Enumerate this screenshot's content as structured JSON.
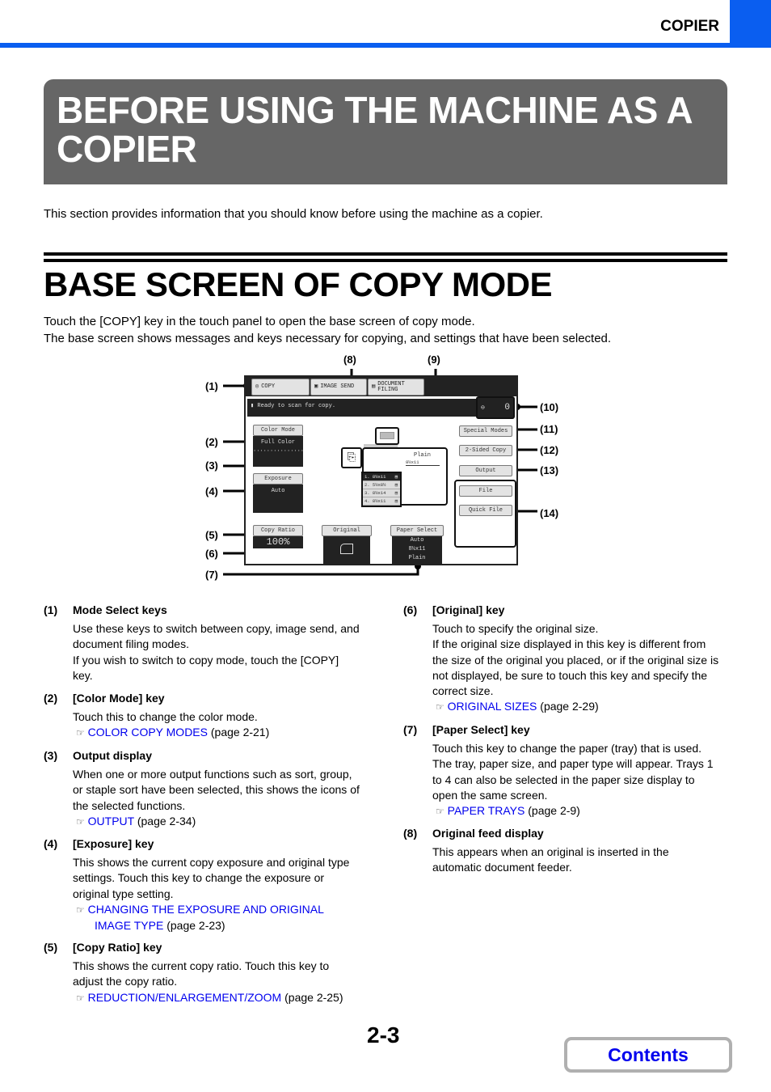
{
  "header": {
    "section_label": "COPIER",
    "accent_color": "#0a5ef0"
  },
  "chapter_title": "BEFORE USING THE MACHINE AS A COPIER",
  "intro": "This section provides information that you should know before using the machine as a copier.",
  "section": {
    "title": "BASE SCREEN OF COPY MODE",
    "paragraphs": [
      "Touch the [COPY] key in the touch panel to open the base screen of copy mode.",
      "The base screen shows messages and keys necessary for copying, and settings that have been selected."
    ]
  },
  "diagram": {
    "callouts": [
      "(1)",
      "(2)",
      "(3)",
      "(4)",
      "(5)",
      "(6)",
      "(7)",
      "(8)",
      "(9)",
      "(10)",
      "(11)",
      "(12)",
      "(13)",
      "(14)"
    ],
    "mode_keys": [
      "COPY",
      "IMAGE SEND",
      "DOCUMENT FILING"
    ],
    "message": "Ready to scan for copy.",
    "copy_count": "0",
    "color_mode": {
      "label": "Color Mode",
      "value": "Full Color"
    },
    "exposure": {
      "label": "Exposure",
      "value": "Auto"
    },
    "copy_ratio": {
      "label": "Copy Ratio",
      "value": "100%"
    },
    "original": {
      "label": "Original"
    },
    "paper_select": {
      "label": "Paper Select",
      "lines": [
        "Auto",
        "8½x11",
        "Plain"
      ]
    },
    "paper_display": {
      "type": "Plain",
      "size": "8½x11"
    },
    "trays": [
      "1. 8½x11",
      "2. 5½x8½",
      "3. 8½x14",
      "4. 8½x11"
    ],
    "right_keys": [
      "Special Modes",
      "2-Sided Copy",
      "Output"
    ],
    "file_keys": [
      "File",
      "Quick File"
    ]
  },
  "descriptions": [
    {
      "num": "(1)",
      "head": "Mode Select keys",
      "lines": [
        "Use these keys to switch between copy, image send, and",
        "document filing modes.",
        "If you wish to switch to copy mode, touch the [COPY]",
        "key."
      ]
    },
    {
      "num": "(2)",
      "head": "[Color Mode] key",
      "lines": [
        "Touch this to change the color mode."
      ],
      "ref": {
        "link": "COLOR COPY MODES",
        "page": "(page 2-21)"
      }
    },
    {
      "num": "(3)",
      "head": "Output display",
      "lines": [
        "When one or more output functions such as sort, group,",
        "or staple sort have been selected, this shows the icons of",
        "the selected functions."
      ],
      "ref": {
        "link": "OUTPUT",
        "page": "(page 2-34)"
      }
    },
    {
      "num": "(4)",
      "head": "[Exposure] key",
      "lines": [
        "This shows the current copy exposure and original type",
        "settings. Touch this key to change the exposure or",
        "original type setting."
      ],
      "ref": {
        "link": "CHANGING THE EXPOSURE AND ORIGINAL",
        "link2": "IMAGE TYPE",
        "page": "(page 2-23)"
      }
    },
    {
      "num": "(5)",
      "head": "[Copy Ratio] key",
      "lines": [
        "This shows the current copy ratio. Touch this key to",
        "adjust the copy ratio."
      ],
      "ref": {
        "link": "REDUCTION/ENLARGEMENT/ZOOM",
        "page": "(page 2-25)"
      }
    },
    {
      "num": "(6)",
      "head": "[Original] key",
      "lines": [
        "Touch to specify the original size.",
        "If the original size displayed in this key is different from",
        "the size of the original you placed, or if the original size is",
        "not displayed, be sure to touch this key and specify the",
        "correct size."
      ],
      "ref": {
        "link": "ORIGINAL SIZES",
        "page": "(page 2-29)"
      }
    },
    {
      "num": "(7)",
      "head": "[Paper Select] key",
      "lines": [
        "Touch this key to change the paper (tray) that is used.",
        "The tray, paper size, and paper type will appear. Trays 1",
        "to 4 can also be selected in the paper size display to",
        "open the same screen."
      ],
      "ref": {
        "link": "PAPER TRAYS",
        "page": "(page 2-9)"
      }
    },
    {
      "num": "(8)",
      "head": "Original feed display",
      "lines": [
        "This appears when an original is inserted in the",
        "automatic document feeder."
      ]
    }
  ],
  "ref_icon": "☞",
  "footer": {
    "page_number": "2-3",
    "contents_label": "Contents"
  }
}
